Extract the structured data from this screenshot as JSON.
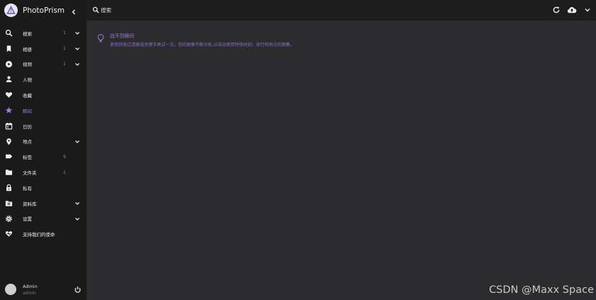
{
  "app": {
    "name": "PhotoPrism"
  },
  "search": {
    "placeholder": "搜索"
  },
  "sidebar": {
    "items": [
      {
        "label": "搜索",
        "count": "1",
        "icon": "search-icon",
        "chevron": true
      },
      {
        "label": "相册",
        "count": "1",
        "icon": "bookmark-icon",
        "chevron": true
      },
      {
        "label": "视频",
        "count": "1",
        "icon": "play-circle-icon",
        "chevron": true
      },
      {
        "label": "人物",
        "count": "",
        "icon": "person-icon",
        "chevron": false
      },
      {
        "label": "收藏",
        "count": "",
        "icon": "heart-icon",
        "chevron": false
      },
      {
        "label": "瞬间",
        "count": "",
        "icon": "star-icon",
        "chevron": false,
        "active": true
      },
      {
        "label": "日历",
        "count": "",
        "icon": "calendar-icon",
        "chevron": false
      },
      {
        "label": "地点",
        "count": "",
        "icon": "map-pin-icon",
        "chevron": true
      },
      {
        "label": "标签",
        "count": "9",
        "icon": "label-icon",
        "chevron": false
      },
      {
        "label": "文件夹",
        "count": "2",
        "icon": "folder-icon",
        "chevron": false
      },
      {
        "label": "私有",
        "count": "",
        "icon": "lock-icon",
        "chevron": false
      },
      {
        "label": "资料库",
        "count": "",
        "icon": "library-icon",
        "chevron": true
      },
      {
        "label": "设置",
        "count": "",
        "icon": "gear-icon",
        "chevron": true
      },
      {
        "label": "支持我们的使命",
        "count": "",
        "icon": "heart-support-icon",
        "chevron": false
      }
    ]
  },
  "user": {
    "name": "Admin",
    "login": "admin"
  },
  "notice": {
    "title": "找不到瞬间",
    "text": "使用其他过滤器或关键字再试一次。你的图像不断分析,以自动使用特殊时刻、旅行和地点的图集。"
  },
  "watermark": "CSDN @Maxx Space",
  "colors": {
    "accent": "#9f7bd8",
    "sidebar_bg": "#1a1a1b",
    "content_bg": "#2c2c2e"
  }
}
